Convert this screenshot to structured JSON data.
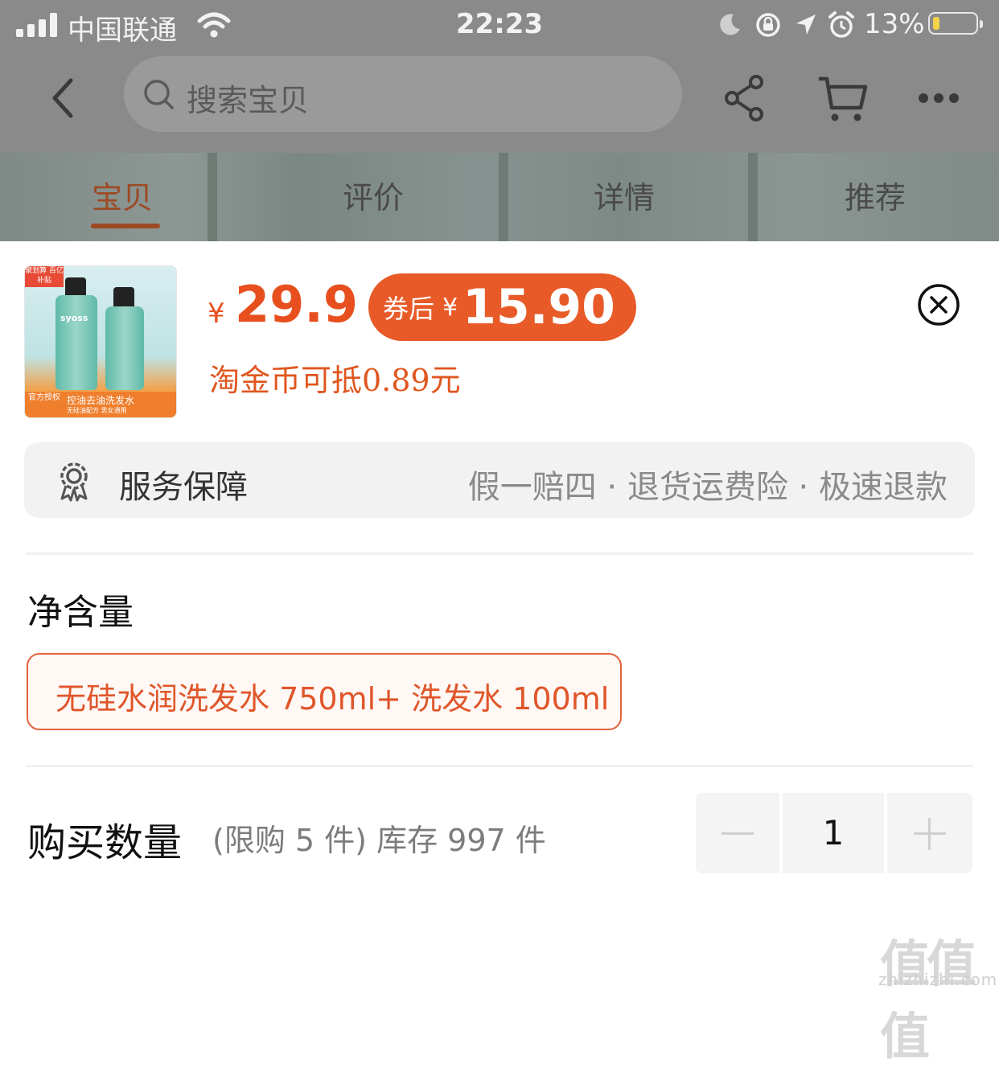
{
  "status_bar": {
    "carrier": "中国联通",
    "time": "22:23",
    "battery_percent": "13%",
    "battery_level": 0.13
  },
  "nav": {
    "search_placeholder": "搜索宝贝",
    "icons": [
      "back-icon",
      "search-icon",
      "share-icon",
      "cart-icon",
      "more-icon"
    ]
  },
  "tabs": [
    {
      "label": "宝贝",
      "active": true
    },
    {
      "label": "评价",
      "active": false
    },
    {
      "label": "详情",
      "active": false
    },
    {
      "label": "推荐",
      "active": false
    }
  ],
  "product": {
    "currency": "¥",
    "price": "29.9",
    "coupon_label": "券后",
    "coupon_currency": "¥",
    "coupon_price": "15.90",
    "coin_note": "淘金币可抵0.89元",
    "thumbnail": {
      "badge": "聚划算 百亿补贴",
      "brand": "syoss",
      "caption": "控油去油洗发水",
      "sub_caption": "无硅油配方 男女通用",
      "auth": "官方授权"
    }
  },
  "service": {
    "title": "服务保障",
    "description": "假一赔四 · 退货运费险 · 极速退款"
  },
  "spec": {
    "title": "净含量",
    "options": [
      {
        "label": "无硅水润洗发水 750ml+ 洗发水 100ml",
        "selected": true
      }
    ]
  },
  "quantity": {
    "title": "购买数量",
    "limit_text": "(限购 5 件) 库存 997 件",
    "value": "1"
  },
  "watermark": {
    "text": "值值值",
    "url": "zhizhizhi.com"
  },
  "colors": {
    "accent": "#e84f1e",
    "coupon_bg": "#e85a27",
    "overlay": "#8a8a8a"
  }
}
